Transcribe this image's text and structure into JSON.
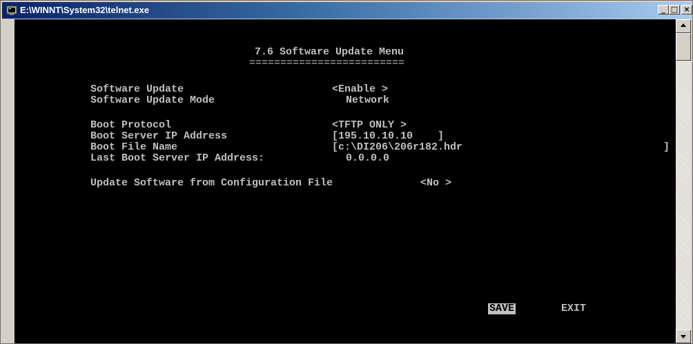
{
  "window": {
    "title": "E:\\WINNT\\System32\\telnet.exe",
    "buttons": {
      "minimize": "_",
      "maximize": "□",
      "close": "×"
    }
  },
  "terminal": {
    "heading": "7.6 Software Update Menu",
    "underline": "=========================",
    "software_update": {
      "label": "Software Update",
      "value": "<Enable >"
    },
    "software_update_mode": {
      "label": "Software Update Mode",
      "value": "Network"
    },
    "boot_protocol": {
      "label": "Boot Protocol",
      "value": "<TFTP ONLY >"
    },
    "boot_server_ip": {
      "label": "Boot Server IP Address",
      "value": "[195.10.10.10    ]"
    },
    "boot_file_name": {
      "label": "Boot File Name",
      "value": "[c:\\DI206\\206r182.hdr",
      "close": "]"
    },
    "last_boot_server_ip": {
      "label": "Last Boot Server IP Address:",
      "value": "0.0.0.0"
    },
    "update_from_config": {
      "label": "Update Software from Configuration File",
      "value": "<No >"
    },
    "save_label": "SAVE",
    "exit_label": "EXIT"
  },
  "colors": {
    "terminal_bg": "#000000",
    "terminal_text": "#c0c0c0",
    "titlebar": "#0a246a"
  }
}
